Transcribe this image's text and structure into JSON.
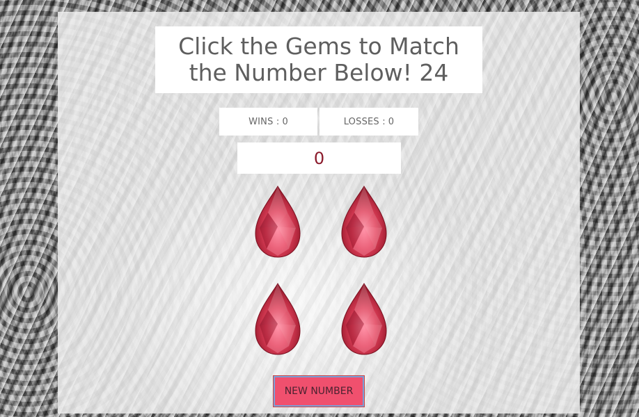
{
  "game": {
    "title": "Click the Gems to Match the Number Below! 24",
    "wins_label": "WINS :",
    "wins": "0",
    "losses_label": "LOSSES :",
    "losses": "0",
    "current_score": "0",
    "new_number_label": "NEW NUMBER",
    "gems": [
      {
        "icon": "ruby-gem-icon"
      },
      {
        "icon": "ruby-gem-icon"
      },
      {
        "icon": "ruby-gem-icon"
      },
      {
        "icon": "ruby-gem-icon"
      }
    ]
  },
  "colors": {
    "score_text": "#8b1a2b",
    "button_bg": "#f0506e",
    "gem_red": "#c8283c"
  }
}
